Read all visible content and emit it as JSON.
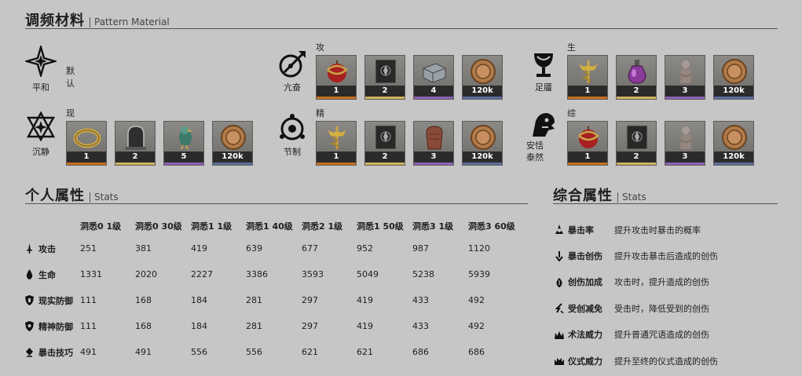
{
  "pattern": {
    "title": "调频材料",
    "subtitle": "Pattern Material",
    "modes": [
      {
        "name": "平和",
        "icon": "four-point-star-icon",
        "label": "默认",
        "materials": []
      },
      {
        "name": "沉静",
        "icon": "triangle-star-icon",
        "label": "现实防御",
        "materials": [
          {
            "icon": "golden-ring-icon",
            "count": "1",
            "quality": "orange"
          },
          {
            "icon": "bell-jar-icon",
            "count": "2",
            "quality": "yellow"
          },
          {
            "icon": "green-bird-icon",
            "count": "5",
            "quality": "purple"
          },
          {
            "icon": "bronze-coin-icon",
            "count": "120k",
            "quality": "blue"
          }
        ]
      },
      {
        "name": "亢奋",
        "icon": "arrow-circle-icon",
        "label": "攻击",
        "materials": [
          {
            "icon": "red-apple-serpent-icon",
            "count": "1",
            "quality": "orange"
          },
          {
            "icon": "dark-tome-icon",
            "count": "2",
            "quality": "yellow"
          },
          {
            "icon": "metal-brick-icon",
            "count": "4",
            "quality": "purple"
          },
          {
            "icon": "bronze-coin-icon",
            "count": "120k",
            "quality": "blue"
          }
        ]
      },
      {
        "name": "节制",
        "icon": "orbit-circle-icon",
        "label": "精神防御",
        "materials": [
          {
            "icon": "golden-caduceus-icon",
            "count": "1",
            "quality": "orange"
          },
          {
            "icon": "dark-tome-icon",
            "count": "2",
            "quality": "yellow"
          },
          {
            "icon": "clay-figure-icon",
            "count": "3",
            "quality": "purple"
          },
          {
            "icon": "bronze-coin-icon",
            "count": "120k",
            "quality": "blue"
          }
        ]
      },
      {
        "name": "足餍",
        "icon": "chalice-icon",
        "label": "生命",
        "materials": [
          {
            "icon": "golden-caduceus-icon",
            "count": "1",
            "quality": "orange"
          },
          {
            "icon": "purple-potion-icon",
            "count": "2",
            "quality": "yellow"
          },
          {
            "icon": "stone-statue-icon",
            "count": "3",
            "quality": "purple"
          },
          {
            "icon": "bronze-coin-icon",
            "count": "120k",
            "quality": "blue"
          }
        ]
      },
      {
        "name": "安恬泰然",
        "icon": "lion-head-icon",
        "label": "综合",
        "materials": [
          {
            "icon": "red-apple-serpent-icon",
            "count": "1",
            "quality": "orange"
          },
          {
            "icon": "dark-tome-icon",
            "count": "2",
            "quality": "yellow"
          },
          {
            "icon": "stone-statue-icon",
            "count": "3",
            "quality": "purple"
          },
          {
            "icon": "bronze-coin-icon",
            "count": "120k",
            "quality": "blue"
          }
        ]
      }
    ]
  },
  "stats": {
    "title": "个人属性",
    "subtitle": "Stats",
    "columns": [
      "洞悉0 1级",
      "洞悉0 30级",
      "洞悉1 1级",
      "洞悉1 40级",
      "洞悉2 1级",
      "洞悉1 50级",
      "洞悉3 1级",
      "洞悉3 60级"
    ],
    "rows": [
      {
        "name": "攻击",
        "icon": "attack-dagger-icon",
        "values": [
          "251",
          "381",
          "419",
          "639",
          "677",
          "952",
          "987",
          "1120"
        ]
      },
      {
        "name": "生命",
        "icon": "life-drop-icon",
        "values": [
          "1331",
          "2020",
          "2227",
          "3386",
          "3593",
          "5049",
          "5238",
          "5939"
        ]
      },
      {
        "name": "现实防御",
        "icon": "reality-shield-icon",
        "values": [
          "111",
          "168",
          "184",
          "281",
          "297",
          "419",
          "433",
          "492"
        ]
      },
      {
        "name": "精神防御",
        "icon": "mental-shield-icon",
        "values": [
          "111",
          "168",
          "184",
          "281",
          "297",
          "419",
          "433",
          "492"
        ]
      },
      {
        "name": "暴击技巧",
        "icon": "crit-technique-icon",
        "values": [
          "491",
          "491",
          "556",
          "556",
          "621",
          "621",
          "686",
          "686"
        ]
      }
    ]
  },
  "aggregate": {
    "title": "综合属性",
    "subtitle": "Stats",
    "items": [
      {
        "name": "暴击率",
        "icon": "crit-rate-icon",
        "desc": "提升攻击时暴击的概率"
      },
      {
        "name": "暴击创伤",
        "icon": "crit-damage-icon",
        "desc": "提升攻击暴击后造成的创伤"
      },
      {
        "name": "创伤加成",
        "icon": "damage-bonus-icon",
        "desc": "攻击时，提升造成的创伤"
      },
      {
        "name": "受创减免",
        "icon": "damage-taken-reduction-icon",
        "desc": "受击时，降低受到的创伤"
      },
      {
        "name": "术法威力",
        "icon": "arcane-power-icon",
        "desc": "提升普通咒语造成的创伤"
      },
      {
        "name": "仪式威力",
        "icon": "ritual-power-icon",
        "desc": "提升至终的仪式造成的创伤"
      }
    ]
  }
}
